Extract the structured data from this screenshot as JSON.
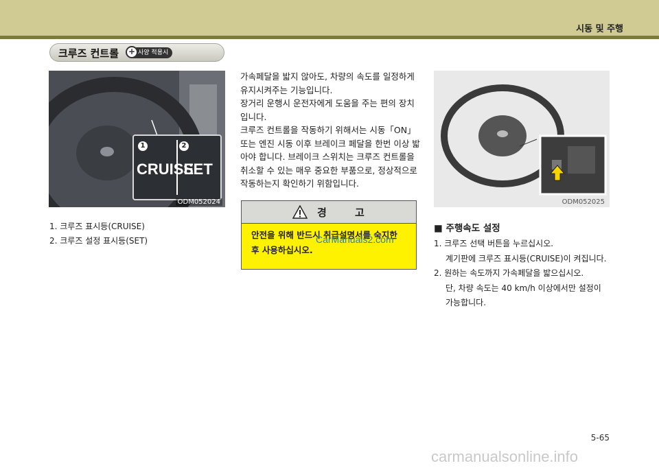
{
  "header": {
    "section_label": "시동 및 주행"
  },
  "title": {
    "text": "크루즈 컨트롤",
    "badge": "사양 적용시",
    "badge_plus": "+"
  },
  "left_image": {
    "code": "ODM052024",
    "label_cruise": "CRUISE",
    "label_set": "SET",
    "num1": "1",
    "num2": "2"
  },
  "left_list": [
    "1.  크루즈 표시등(CRUISE)",
    "2.  크루즈 설정 표시등(SET)"
  ],
  "mid_paragraphs": [
    "가속페달을 밟지 않아도, 차량의 속도를 일정하게 유지시켜주는 기능입니다.",
    "장거리 운행시 운전자에게 도움을 주는 편의 장치입니다.",
    "크루즈 컨트롤을 작동하기 위해서는 시동「ON」 또는 엔진 시동 이후 브레이크 페달을 한번 이상 밟아야 합니다. 브레이크 스위치는 크루즈 컨트롤을 취소할 수 있는 매우 중요한 부품으로, 정상적으로 작동하는지 확인하기 위함입니다."
  ],
  "warning": {
    "title": "경 고",
    "line1": "안전을 위해 반드시 취급설명서를 숙지한",
    "line2": "후 사용하십시오.",
    "watermark": "CarManuals2.com"
  },
  "right_image": {
    "code": "ODM052025"
  },
  "right_section": {
    "heading": "■ 주행속도 설정",
    "items": [
      "1.  크루즈 선택 버튼을 누르십시오.",
      "계기판에 크루즈 표시등(CRUISE)이 켜집니다.",
      "2.  원하는 속도까지 가속페달을 밟으십시오.",
      "단, 차량 속도는 40 km/h 이상에서만 설정이",
      "가능합니다."
    ]
  },
  "page_number": "5-65",
  "footer_watermark": "carmanualsonline.info",
  "colors": {
    "topbar": "#cfcb93",
    "topbar_line": "#7d7a3f",
    "warning_yellow": "#fff200"
  }
}
